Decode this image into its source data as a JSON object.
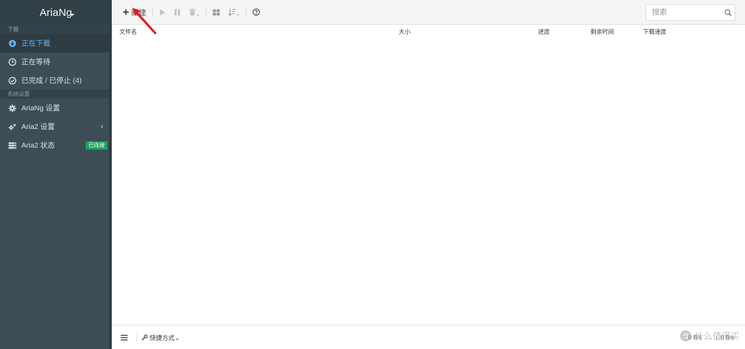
{
  "app": {
    "title": "AriaNg"
  },
  "sidebar": {
    "sections": [
      {
        "header": "下载",
        "items": [
          {
            "label": "正在下载",
            "icon": "download-circle-icon",
            "active": true
          },
          {
            "label": "正在等待",
            "icon": "clock-icon",
            "active": false
          },
          {
            "label": "已完成 / 已停止 (4)",
            "icon": "check-circle-icon",
            "active": false
          }
        ]
      },
      {
        "header": "系统设置",
        "items": [
          {
            "label": "AriaNg 设置",
            "icon": "gear-icon"
          },
          {
            "label": "Aria2 设置",
            "icon": "gears-icon",
            "chevron": "‹"
          },
          {
            "label": "Aria2 状态",
            "icon": "server-icon",
            "badge": "已连接"
          }
        ]
      }
    ]
  },
  "toolbar": {
    "new_label": "新建",
    "buttons": [
      "play-icon",
      "pause-icon",
      "trash-icon",
      "grid-icon",
      "sort-icon",
      "help-icon"
    ]
  },
  "search": {
    "placeholder": "搜索"
  },
  "table": {
    "columns": [
      "文件名",
      "大小",
      "进度",
      "剩余时间",
      "下载速度"
    ]
  },
  "footer": {
    "shortcut_label": "快捷方式",
    "upload_speed": "0 B/s",
    "download_speed": "0 B/s"
  },
  "watermark": {
    "text": "什么值得买"
  },
  "colors": {
    "sidebar_bg": "#3c4d56",
    "brand_bg": "#313f47",
    "active_text": "#5fb5f5",
    "badge_bg": "#1aa35d",
    "arrow": "#e01b24"
  }
}
